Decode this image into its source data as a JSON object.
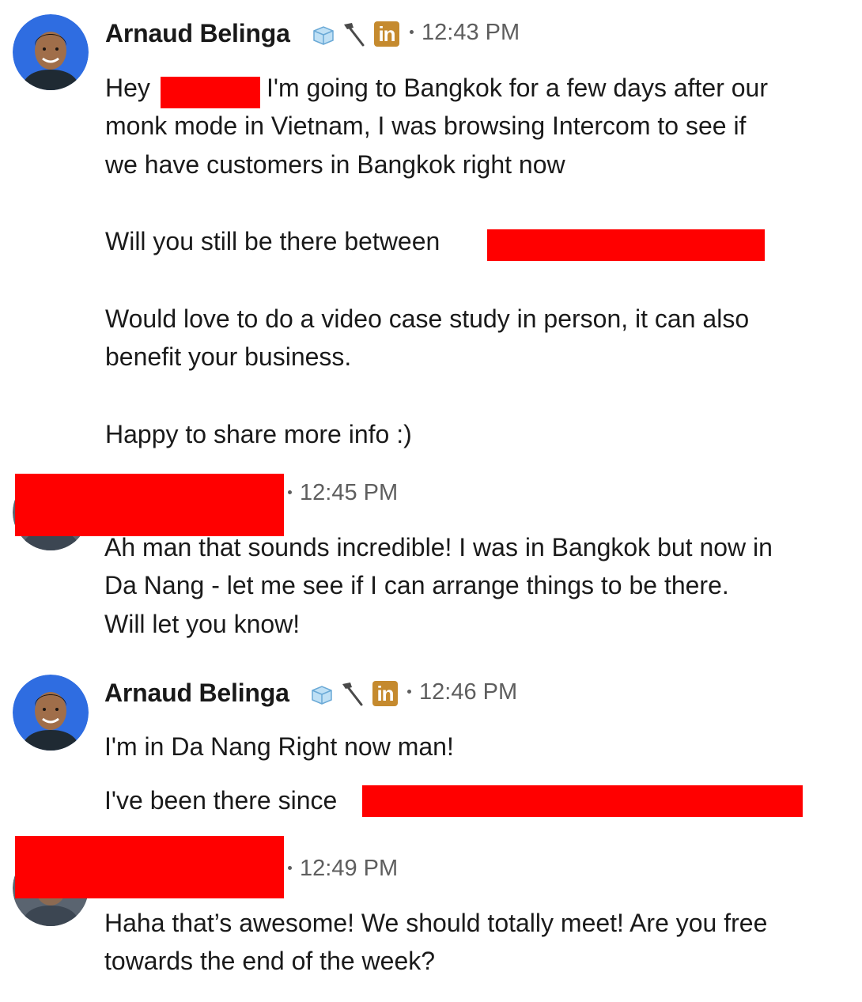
{
  "conversation": {
    "messages": [
      {
        "sender": "Arnaud Belinga",
        "time": "12:43 PM",
        "lines": [
          "Hey",
          "I'm going to Bangkok for a few days after our",
          "monk mode in Vietnam, I was browsing Intercom to see if",
          "we have customers in Bangkok right now",
          "Will you still be there between",
          "Would love to do a video case study in person, it can also",
          "benefit your business.",
          "Happy to share more info :)"
        ]
      },
      {
        "sender": "",
        "time": "12:45 PM",
        "lines": [
          "Ah man that sounds incredible! I was in Bangkok but now in",
          "Da Nang - let me see if I can arrange things to be there.",
          "Will let you know!"
        ]
      },
      {
        "sender": "Arnaud Belinga",
        "time": "12:46 PM",
        "lines": [
          "I'm in Da Nang Right now man!",
          "I've been there since"
        ]
      },
      {
        "sender": "",
        "time": "12:49 PM",
        "lines": [
          "Haha that’s awesome! We should totally meet! Are you free",
          "towards the end of the week?"
        ]
      }
    ],
    "badges": {
      "linkedin_text": "in"
    }
  },
  "colors": {
    "redaction": "#ff0000",
    "linkedin_badge": "#c58a2e",
    "avatar_ring": "#2f6de1",
    "meta_text": "#5e5e5e"
  },
  "icons": [
    "ice-cube-icon",
    "hammer-icon",
    "linkedin-icon",
    "bullet-dot-icon",
    "avatar"
  ]
}
